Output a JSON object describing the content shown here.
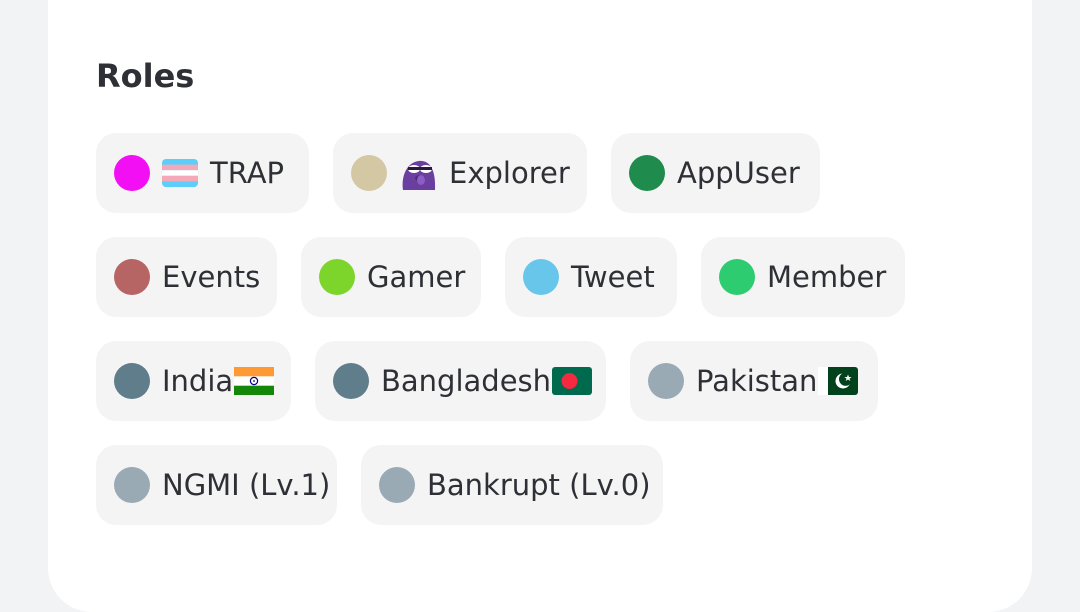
{
  "section": {
    "title": "Roles"
  },
  "roles": [
    {
      "label": "TRAP",
      "color": "#f30ff3",
      "icon": "transgender-flag-emoji"
    },
    {
      "label": "Explorer",
      "color": "#d4c7a3",
      "icon": "purple-pepe-emoji"
    },
    {
      "label": "AppUser",
      "color": "#1f8b4c"
    },
    {
      "label": "Events",
      "color": "#b66464"
    },
    {
      "label": "Gamer",
      "color": "#7dd42a"
    },
    {
      "label": "Tweet",
      "color": "#68c6ea"
    },
    {
      "label": "Member",
      "color": "#2ecc71"
    },
    {
      "label": "India",
      "color": "#607d8b",
      "icon": "india-flag-emoji"
    },
    {
      "label": "Bangladesh",
      "color": "#607d8b",
      "icon": "bangladesh-flag-emoji"
    },
    {
      "label": "Pakistan",
      "color": "#99aab5",
      "icon": "pakistan-flag-emoji"
    },
    {
      "label": "NGMI (Lv.1)",
      "color": "#99aab5"
    },
    {
      "label": "Bankrupt (Lv.0)",
      "color": "#99aab5"
    }
  ]
}
